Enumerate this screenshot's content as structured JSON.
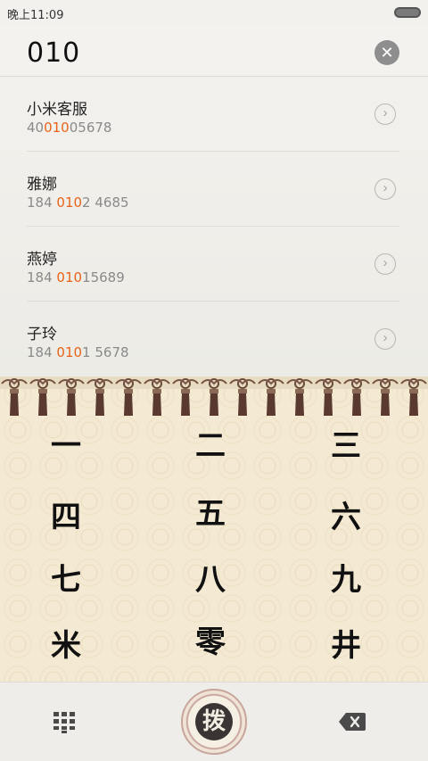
{
  "status_bar": {
    "time": "晚上11:09",
    "battery_icon": "battery-icon"
  },
  "search": {
    "query": "010",
    "clear_icon": "close-icon"
  },
  "results": [
    {
      "name": "小米客服",
      "number_pre": "40",
      "number_match": "010",
      "number_post": "05678"
    },
    {
      "name": "雅娜",
      "number_pre": "184 ",
      "number_match": "010",
      "number_post": "2 4685"
    },
    {
      "name": "燕婷",
      "number_pre": "184 ",
      "number_match": "010",
      "number_post": "15689"
    },
    {
      "name": "子玲",
      "number_pre": "184 ",
      "number_match": "010",
      "number_post": "1 5678"
    }
  ],
  "colors": {
    "match_highlight": "#e8631a",
    "keypad_background": "#f4ead3"
  },
  "keypad": {
    "k1": "一",
    "k2": "二",
    "k3": "三",
    "k4": "四",
    "k5": "五",
    "k6": "六",
    "k7": "七",
    "k8": "八",
    "k9": "九",
    "kstar": "米",
    "k0": "零",
    "khash": "井"
  },
  "bottom_bar": {
    "dial_label": "拨",
    "dialpad_icon": "dialpad-icon",
    "backspace_icon": "backspace-icon"
  }
}
